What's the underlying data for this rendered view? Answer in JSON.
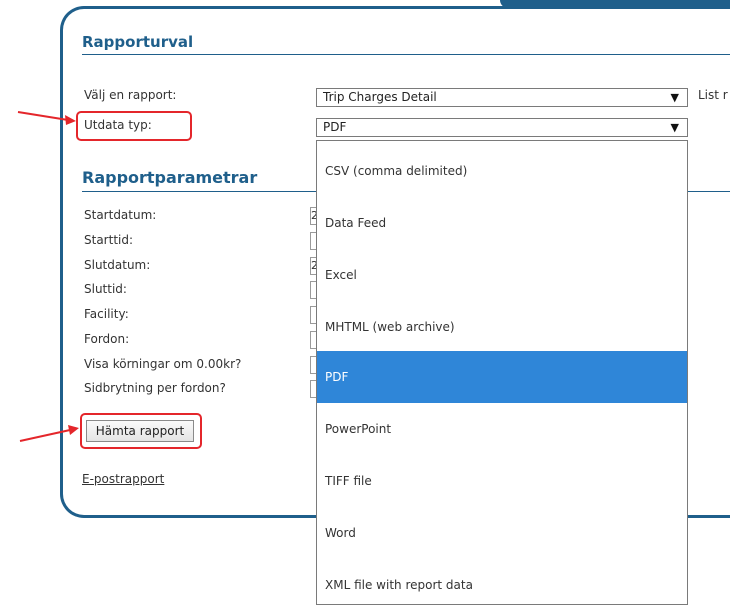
{
  "report_selection": {
    "title": "Rapporturval",
    "choose_report_label": "Välj en rapport:",
    "choose_report_value": "Trip Charges Detail",
    "output_type_label": "Utdata typ:",
    "output_type_value": "PDF",
    "list_hint": "List r"
  },
  "report_parameters": {
    "title": "Rapportparametrar",
    "fields": [
      {
        "label": "Startdatum:",
        "stub": "2"
      },
      {
        "label": "Starttid:",
        "stub": ""
      },
      {
        "label": "Slutdatum:",
        "stub": "2"
      },
      {
        "label": "Sluttid:",
        "stub": ""
      },
      {
        "label": "Facility:",
        "stub": ""
      },
      {
        "label": "Fordon:",
        "stub": ""
      },
      {
        "label": "Visa körningar om 0.00kr?",
        "stub": ""
      },
      {
        "label": "Sidbrytning per fordon?",
        "stub": ""
      }
    ]
  },
  "dropdown": {
    "options": [
      "CSV (comma delimited)",
      "Data Feed",
      "Excel",
      "MHTML (web archive)",
      "PDF",
      "PowerPoint",
      "TIFF file",
      "Word",
      "XML file with report data"
    ],
    "selected": "PDF"
  },
  "actions": {
    "fetch_report_label": "Hämta rapport",
    "email_report_label": "E-postrapport"
  },
  "colors": {
    "accent": "#1f5f8b",
    "highlight": "#e4262b",
    "selection": "#2f86d8"
  },
  "icons": {
    "dropdown_arrow": "triangle-down-icon",
    "annotation_arrow": "arrow-right-icon"
  }
}
